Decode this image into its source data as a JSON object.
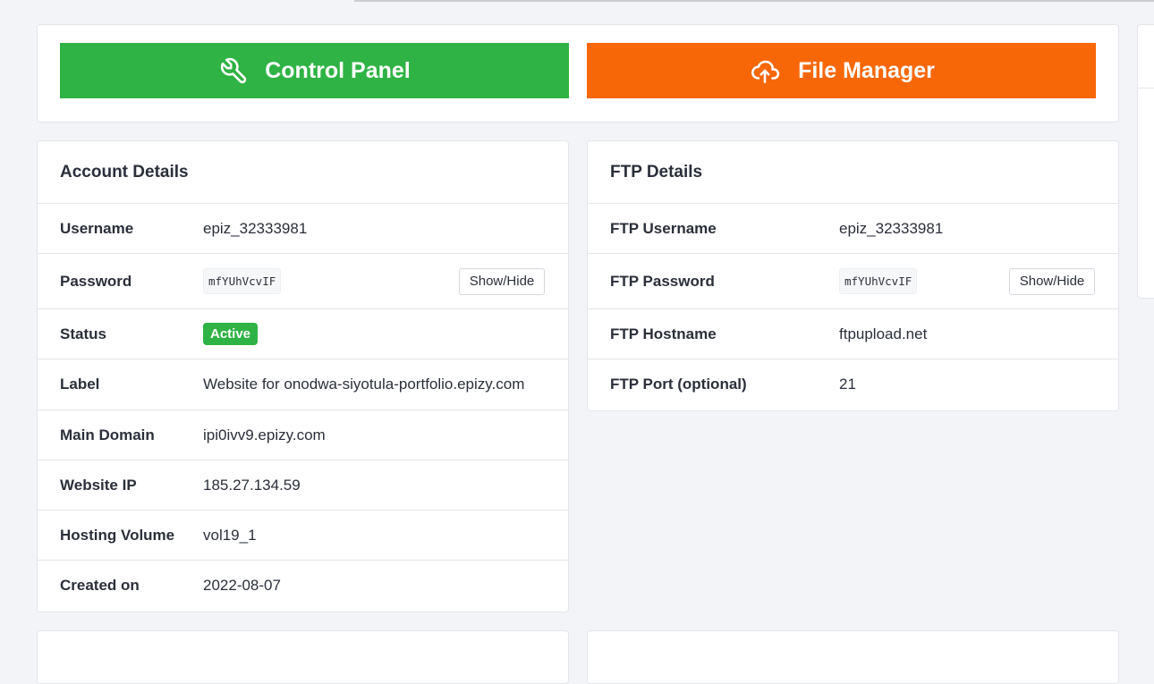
{
  "actions": {
    "control_panel": {
      "label": "Control Panel",
      "icon": "wrench-icon",
      "color": "#2fb344"
    },
    "file_manager": {
      "label": "File Manager",
      "icon": "cloud-upload-icon",
      "color": "#f76707"
    }
  },
  "account": {
    "title": "Account Details",
    "username": {
      "label": "Username",
      "value": "epiz_32333981"
    },
    "password": {
      "label": "Password",
      "value": "mfYUhVcvIF",
      "button": "Show/Hide"
    },
    "status": {
      "label": "Status",
      "value": "Active",
      "color": "#2fb344"
    },
    "label": {
      "label": "Label",
      "value": "Website for onodwa-siyotula-portfolio.epizy.com"
    },
    "main_domain": {
      "label": "Main Domain",
      "value": "ipi0ivv9.epizy.com"
    },
    "website_ip": {
      "label": "Website IP",
      "value": "185.27.134.59"
    },
    "hosting_volume": {
      "label": "Hosting Volume",
      "value": "vol19_1"
    },
    "created_on": {
      "label": "Created on",
      "value": "2022-08-07"
    }
  },
  "ftp": {
    "title": "FTP Details",
    "username": {
      "label": "FTP Username",
      "value": "epiz_32333981"
    },
    "password": {
      "label": "FTP Password",
      "value": "mfYUhVcvIF",
      "button": "Show/Hide"
    },
    "hostname": {
      "label": "FTP Hostname",
      "value": "ftpupload.net"
    },
    "port": {
      "label": "FTP Port (optional)",
      "value": "21"
    }
  }
}
